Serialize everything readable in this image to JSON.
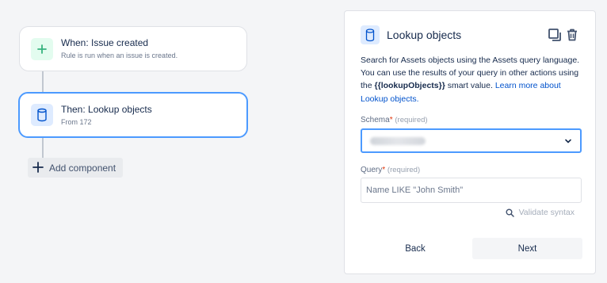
{
  "flow": {
    "trigger": {
      "title": "When: Issue created",
      "subtitle": "Rule is run when an issue is created.",
      "icon": "plus-icon"
    },
    "action": {
      "title": "Then: Lookup objects",
      "subtitle": "From 172",
      "icon": "database-icon"
    },
    "add_component_label": "Add component"
  },
  "panel": {
    "title": "Lookup objects",
    "description_part1": "Search for Assets objects using the Assets query language. You can use the results of your query in other actions using the ",
    "smart_value": "{{lookupObjects}}",
    "description_part2": " smart value. ",
    "learn_more_link": "Learn more about Lookup objects.",
    "schema": {
      "label": "Schema",
      "required_mark": "*",
      "hint": "(required)"
    },
    "query": {
      "label": "Query",
      "required_mark": "*",
      "hint": "(required)",
      "placeholder": "Name LIKE \"John Smith\""
    },
    "validate_label": "Validate syntax",
    "back_label": "Back",
    "next_label": "Next"
  },
  "colors": {
    "accent": "#4c9aff",
    "link": "#0052cc",
    "success": "#36b37e",
    "required": "#de350b"
  }
}
